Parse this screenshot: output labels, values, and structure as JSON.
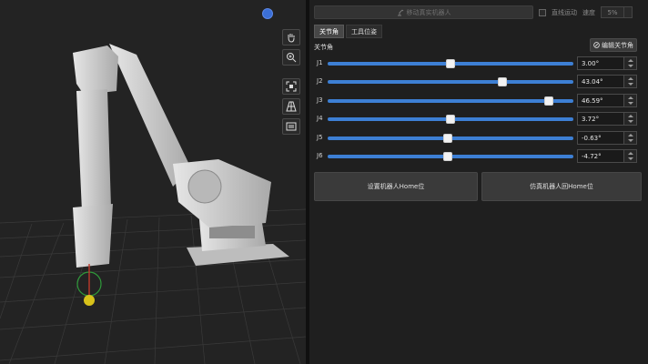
{
  "toolbar": {
    "move_label": "移动真实机器人",
    "linear_motion_label": "直线运动",
    "speed_label": "速度",
    "speed_value": "5%"
  },
  "tabs": [
    {
      "label": "关节角",
      "active": true
    },
    {
      "label": "工具位姿",
      "active": false
    }
  ],
  "section": {
    "title": "关节角",
    "edit_label": "编辑关节角"
  },
  "joints": [
    {
      "label": "J1",
      "value": "3.00°",
      "fraction": 0.5
    },
    {
      "label": "J2",
      "value": "43.04°",
      "fraction": 0.71
    },
    {
      "label": "J3",
      "value": "46.59°",
      "fraction": 0.9
    },
    {
      "label": "J4",
      "value": "3.72°",
      "fraction": 0.5
    },
    {
      "label": "J5",
      "value": "-0.63°",
      "fraction": 0.49
    },
    {
      "label": "J6",
      "value": "-4.72°",
      "fraction": 0.49
    }
  ],
  "actions": {
    "set_home_label": "设置机器人Home位",
    "sim_home_label": "仿真机器人回Home位"
  },
  "icons": {
    "view_tools": [
      "hand-icon",
      "zoom-icon",
      "fit-view-icon",
      "grid-view-icon",
      "panel-icon"
    ]
  },
  "colors": {
    "accent": "#3d7fd4",
    "orientation_dot": "#3b6fd6"
  }
}
